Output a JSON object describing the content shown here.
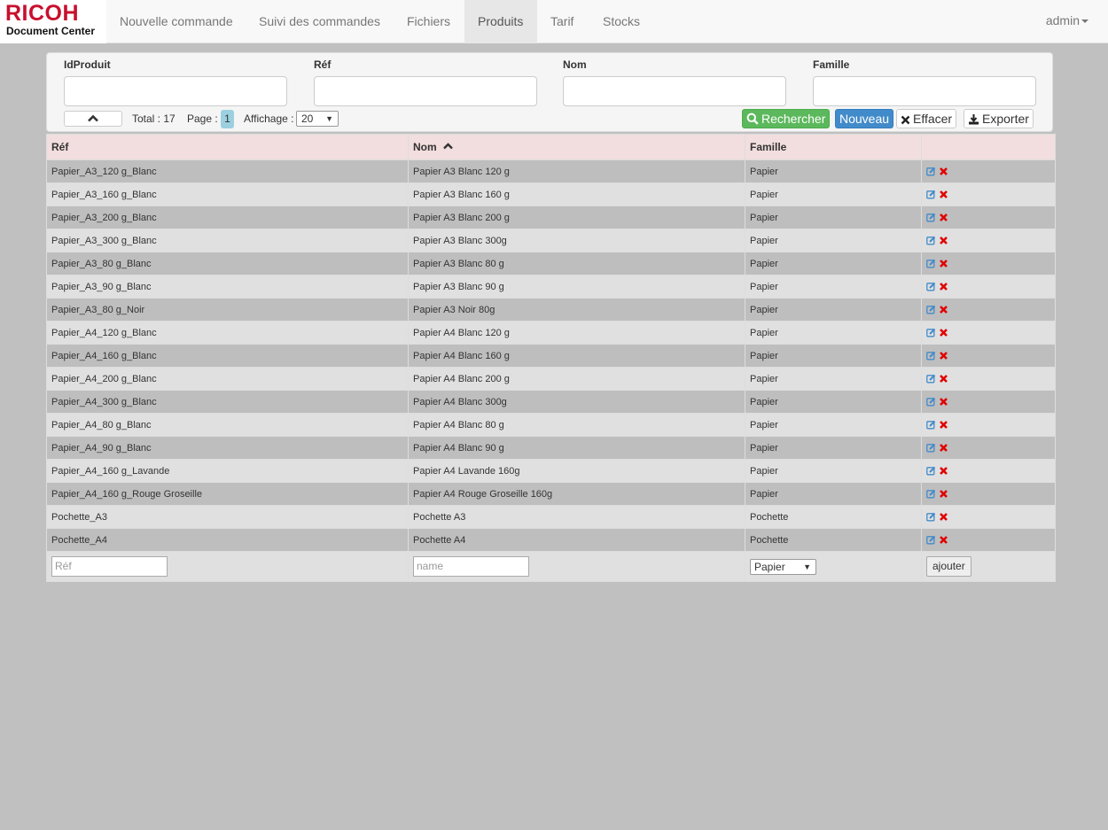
{
  "brand": {
    "name": "RICOH",
    "subtitle": "Document Center",
    "color": "#c8102e"
  },
  "nav": {
    "items": [
      {
        "label": "Nouvelle commande"
      },
      {
        "label": "Suivi des commandes"
      },
      {
        "label": "Fichiers"
      },
      {
        "label": "Produits",
        "active": true
      },
      {
        "label": "Tarif"
      },
      {
        "label": "Stocks"
      }
    ],
    "user": "admin"
  },
  "filters": {
    "fields": [
      {
        "label": "IdProduit",
        "value": ""
      },
      {
        "label": "Réf",
        "value": ""
      },
      {
        "label": "Nom",
        "value": ""
      },
      {
        "label": "Famille",
        "value": ""
      }
    ],
    "total_label": "Total : 17",
    "page_label": "Page :",
    "page_value": "1",
    "display_label": "Affichage :",
    "display_value": "20",
    "buttons": {
      "search": "Rechercher",
      "new": "Nouveau",
      "clear": "Effacer",
      "export": "Exporter"
    }
  },
  "table": {
    "headers": {
      "ref": "Réf",
      "name": "Nom",
      "family": "Famille",
      "actions": ""
    },
    "sort": {
      "column": "name",
      "direction": "asc"
    },
    "rows": [
      {
        "ref": "Papier_A3_120 g_Blanc",
        "name": "Papier A3 Blanc 120 g",
        "family": "Papier"
      },
      {
        "ref": "Papier_A3_160 g_Blanc",
        "name": "Papier A3 Blanc 160 g",
        "family": "Papier"
      },
      {
        "ref": "Papier_A3_200 g_Blanc",
        "name": "Papier A3 Blanc 200 g",
        "family": "Papier"
      },
      {
        "ref": "Papier_A3_300 g_Blanc",
        "name": "Papier A3 Blanc 300g",
        "family": "Papier"
      },
      {
        "ref": "Papier_A3_80 g_Blanc",
        "name": "Papier A3 Blanc 80 g",
        "family": "Papier"
      },
      {
        "ref": "Papier_A3_90 g_Blanc",
        "name": "Papier A3 Blanc 90 g",
        "family": "Papier"
      },
      {
        "ref": "Papier_A3_80 g_Noir",
        "name": "Papier A3 Noir 80g",
        "family": "Papier"
      },
      {
        "ref": "Papier_A4_120 g_Blanc",
        "name": "Papier A4 Blanc 120 g",
        "family": "Papier"
      },
      {
        "ref": "Papier_A4_160 g_Blanc",
        "name": "Papier A4 Blanc 160 g",
        "family": "Papier"
      },
      {
        "ref": "Papier_A4_200 g_Blanc",
        "name": "Papier A4 Blanc 200 g",
        "family": "Papier"
      },
      {
        "ref": "Papier_A4_300 g_Blanc",
        "name": "Papier A4 Blanc 300g",
        "family": "Papier"
      },
      {
        "ref": "Papier_A4_80 g_Blanc",
        "name": "Papier A4 Blanc 80 g",
        "family": "Papier"
      },
      {
        "ref": "Papier_A4_90 g_Blanc",
        "name": "Papier A4 Blanc 90 g",
        "family": "Papier"
      },
      {
        "ref": "Papier_A4_160 g_Lavande",
        "name": "Papier A4 Lavande 160g",
        "family": "Papier"
      },
      {
        "ref": "Papier_A4_160 g_Rouge Groseille",
        "name": "Papier A4 Rouge Groseille 160g",
        "family": "Papier"
      },
      {
        "ref": "Pochette_A3",
        "name": "Pochette A3",
        "family": "Pochette"
      },
      {
        "ref": "Pochette_A4",
        "name": "Pochette A4",
        "family": "Pochette"
      }
    ],
    "footer": {
      "ref_placeholder": "Réf",
      "name_placeholder": "name",
      "family_value": "Papier",
      "add_label": "ajouter"
    }
  },
  "icons": {
    "edit": "edit-icon",
    "delete": "delete-icon",
    "search": "search-icon",
    "clear": "close-icon",
    "export": "download-icon",
    "collapse": "chevron-up-icon",
    "sort": "chevron-up-icon"
  },
  "colors": {
    "header_row": "#f2dede",
    "row_dark": "#bebebe",
    "row_light": "#e0e0e0",
    "edit_icon": "#428bca",
    "delete_icon": "#e00000",
    "search_button": "#5cb85c",
    "new_button": "#428bca",
    "page_badge": "#9cd0e0"
  }
}
